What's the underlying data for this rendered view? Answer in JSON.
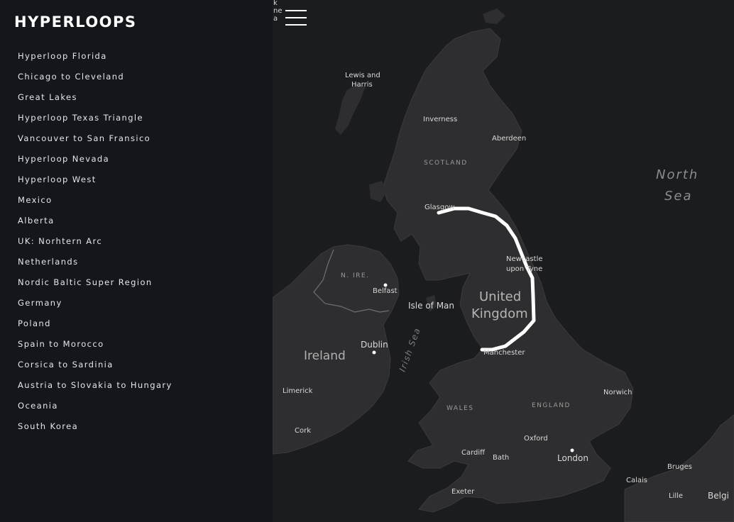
{
  "brand": "HYPERLOOPS",
  "routes": [
    "Hyperloop Florida",
    "Chicago to Cleveland",
    "Great Lakes",
    "Hyperloop Texas Triangle",
    "Vancouver to San Fransico",
    "Hyperloop Nevada",
    "Hyperloop West",
    "Mexico",
    "Alberta",
    "UK: Norhtern Arc",
    "Netherlands",
    "Nordic Baltic Super Region",
    "Germany",
    "Poland",
    "Spain to Morocco",
    "Corsica to Sardinia",
    "Austria to Slovakia to Hungary",
    "Oceania",
    "South Korea"
  ],
  "map": {
    "colors": {
      "land": "#2e2e30",
      "water": "#1b1c1e",
      "route": "#ffffff",
      "border": "#707070"
    },
    "labels": {
      "lewis": "Lewis and",
      "harris": "Harris",
      "inverness": "Inverness",
      "aberdeen": "Aberdeen",
      "scotland": "SCOTLAND",
      "north": "North",
      "sea": "Sea",
      "glasgow": "Glasgow",
      "newcastle1": "Newcastle",
      "newcastle2": "upon Tyne",
      "nire": "N. IRE.",
      "belfast": "Belfast",
      "isle_of_man": "Isle of Man",
      "united": "United",
      "kingdom": "Kingdom",
      "dublin": "Dublin",
      "ireland": "Ireland",
      "irish_sea": "Irish Sea",
      "manchester": "Manchester",
      "limerick": "Limerick",
      "norwich": "Norwich",
      "wales": "WALES",
      "england": "ENGLAND",
      "cork": "Cork",
      "oxford": "Oxford",
      "cardiff": "Cardiff",
      "bath": "Bath",
      "london": "London",
      "calais": "Calais",
      "bruges": "Bruges",
      "lille": "Lille",
      "belgium": "Belgi",
      "exeter": "Exeter",
      "edge1": "k",
      "edge2": "ne",
      "edge3": "a"
    }
  }
}
